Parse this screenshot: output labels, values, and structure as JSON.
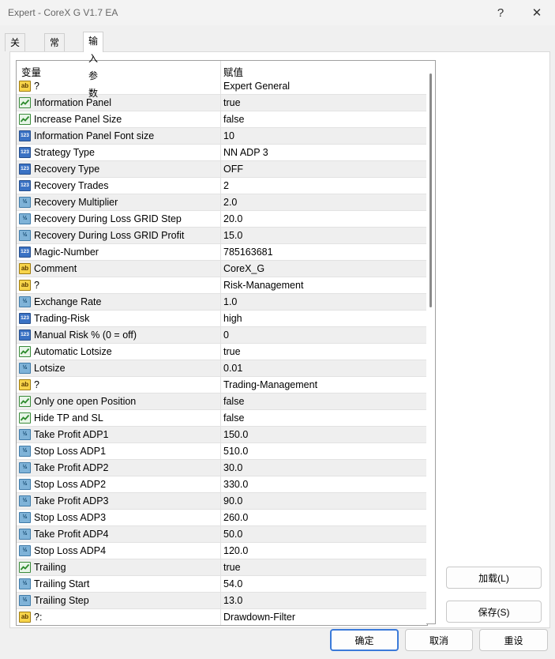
{
  "window": {
    "title": "Expert - CoreX G V1.7 EA",
    "help_icon": "?",
    "close_icon": "✕"
  },
  "tabs": [
    {
      "label": "关于"
    },
    {
      "label": "常用"
    },
    {
      "label": "输入参数"
    }
  ],
  "grid": {
    "col_variable": "变量",
    "col_value": "赋值",
    "rows": [
      {
        "icon": "ab",
        "variable": "?",
        "value": "Expert General"
      },
      {
        "icon": "bool",
        "variable": "Information Panel",
        "value": "true"
      },
      {
        "icon": "bool",
        "variable": "Increase Panel Size",
        "value": "false"
      },
      {
        "icon": "n123",
        "variable": "Information Panel Font size",
        "value": "10"
      },
      {
        "icon": "n123",
        "variable": "Strategy Type",
        "value": "NN ADP 3"
      },
      {
        "icon": "n123",
        "variable": "Recovery Type",
        "value": "OFF"
      },
      {
        "icon": "n123",
        "variable": "Recovery Trades",
        "value": "2"
      },
      {
        "icon": "frac",
        "variable": "Recovery Multiplier",
        "value": "2.0"
      },
      {
        "icon": "frac",
        "variable": "Recovery During Loss GRID Step",
        "value": "20.0"
      },
      {
        "icon": "frac",
        "variable": "Recovery During Loss GRID Profit",
        "value": "15.0"
      },
      {
        "icon": "n123",
        "variable": "Magic-Number",
        "value": "785163681"
      },
      {
        "icon": "ab",
        "variable": "Comment",
        "value": "CoreX_G"
      },
      {
        "icon": "ab",
        "variable": "?",
        "value": "Risk-Management"
      },
      {
        "icon": "frac",
        "variable": "Exchange Rate",
        "value": "1.0"
      },
      {
        "icon": "n123",
        "variable": "Trading-Risk",
        "value": "high"
      },
      {
        "icon": "n123",
        "variable": "Manual Risk % (0 = off)",
        "value": "0"
      },
      {
        "icon": "bool",
        "variable": "Automatic Lotsize",
        "value": "true"
      },
      {
        "icon": "frac",
        "variable": "Lotsize",
        "value": "0.01"
      },
      {
        "icon": "ab",
        "variable": "?",
        "value": "Trading-Management"
      },
      {
        "icon": "bool",
        "variable": "Only one open Position",
        "value": "false"
      },
      {
        "icon": "bool",
        "variable": "Hide TP and SL",
        "value": "false"
      },
      {
        "icon": "frac",
        "variable": "Take Profit ADP1",
        "value": "150.0"
      },
      {
        "icon": "frac",
        "variable": "Stop Loss ADP1",
        "value": "510.0"
      },
      {
        "icon": "frac",
        "variable": "Take Profit ADP2",
        "value": "30.0"
      },
      {
        "icon": "frac",
        "variable": "Stop Loss ADP2",
        "value": "330.0"
      },
      {
        "icon": "frac",
        "variable": "Take Profit ADP3",
        "value": "90.0"
      },
      {
        "icon": "frac",
        "variable": "Stop Loss ADP3",
        "value": "260.0"
      },
      {
        "icon": "frac",
        "variable": "Take Profit ADP4",
        "value": "50.0"
      },
      {
        "icon": "frac",
        "variable": "Stop Loss ADP4",
        "value": "120.0"
      },
      {
        "icon": "bool",
        "variable": "Trailing",
        "value": "true"
      },
      {
        "icon": "frac",
        "variable": "Trailing Start",
        "value": "54.0"
      },
      {
        "icon": "frac",
        "variable": "Trailing Step",
        "value": "13.0"
      },
      {
        "icon": "ab",
        "variable": "?:",
        "value": "Drawdown-Filter"
      }
    ]
  },
  "icon_labels": {
    "ab": "ab",
    "n123": "123",
    "frac": "½"
  },
  "side_buttons": {
    "load": "加载(L)",
    "save": "保存(S)"
  },
  "bottom_buttons": {
    "ok": "确定",
    "cancel": "取消",
    "reset": "重设"
  }
}
